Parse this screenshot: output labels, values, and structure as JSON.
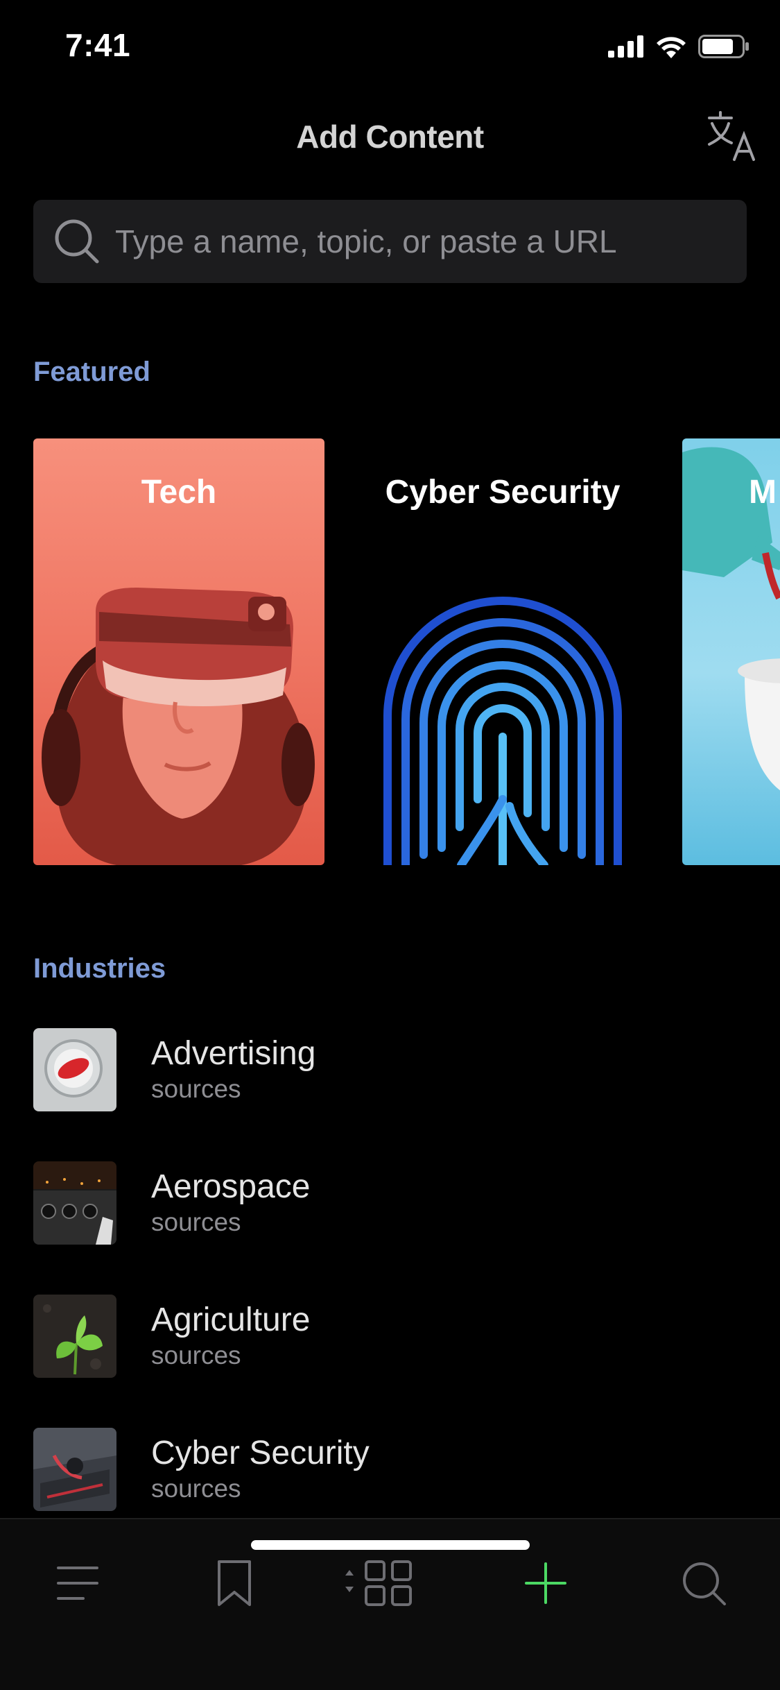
{
  "status_bar": {
    "time": "7:41"
  },
  "header": {
    "title": "Add Content"
  },
  "search": {
    "placeholder": "Type a name, topic, or paste a URL"
  },
  "featured": {
    "heading": "Featured",
    "cards": [
      {
        "label": "Tech"
      },
      {
        "label": "Cyber Security"
      },
      {
        "label": "M"
      }
    ]
  },
  "industries": {
    "heading": "Industries",
    "items": [
      {
        "name": "Advertising",
        "sub": "sources"
      },
      {
        "name": "Aerospace",
        "sub": "sources"
      },
      {
        "name": "Agriculture",
        "sub": "sources"
      },
      {
        "name": "Cyber Security",
        "sub": "sources"
      }
    ]
  },
  "tabbar": {
    "items": [
      {
        "icon": "menu-icon"
      },
      {
        "icon": "bookmark-icon"
      },
      {
        "icon": "grid-icon"
      },
      {
        "icon": "plus-icon",
        "active": true
      },
      {
        "icon": "search-icon"
      }
    ],
    "active_color": "#4cd964",
    "inactive_color": "#6e6e73"
  },
  "colors": {
    "accent": "#7f9bd6",
    "background": "#000000"
  }
}
